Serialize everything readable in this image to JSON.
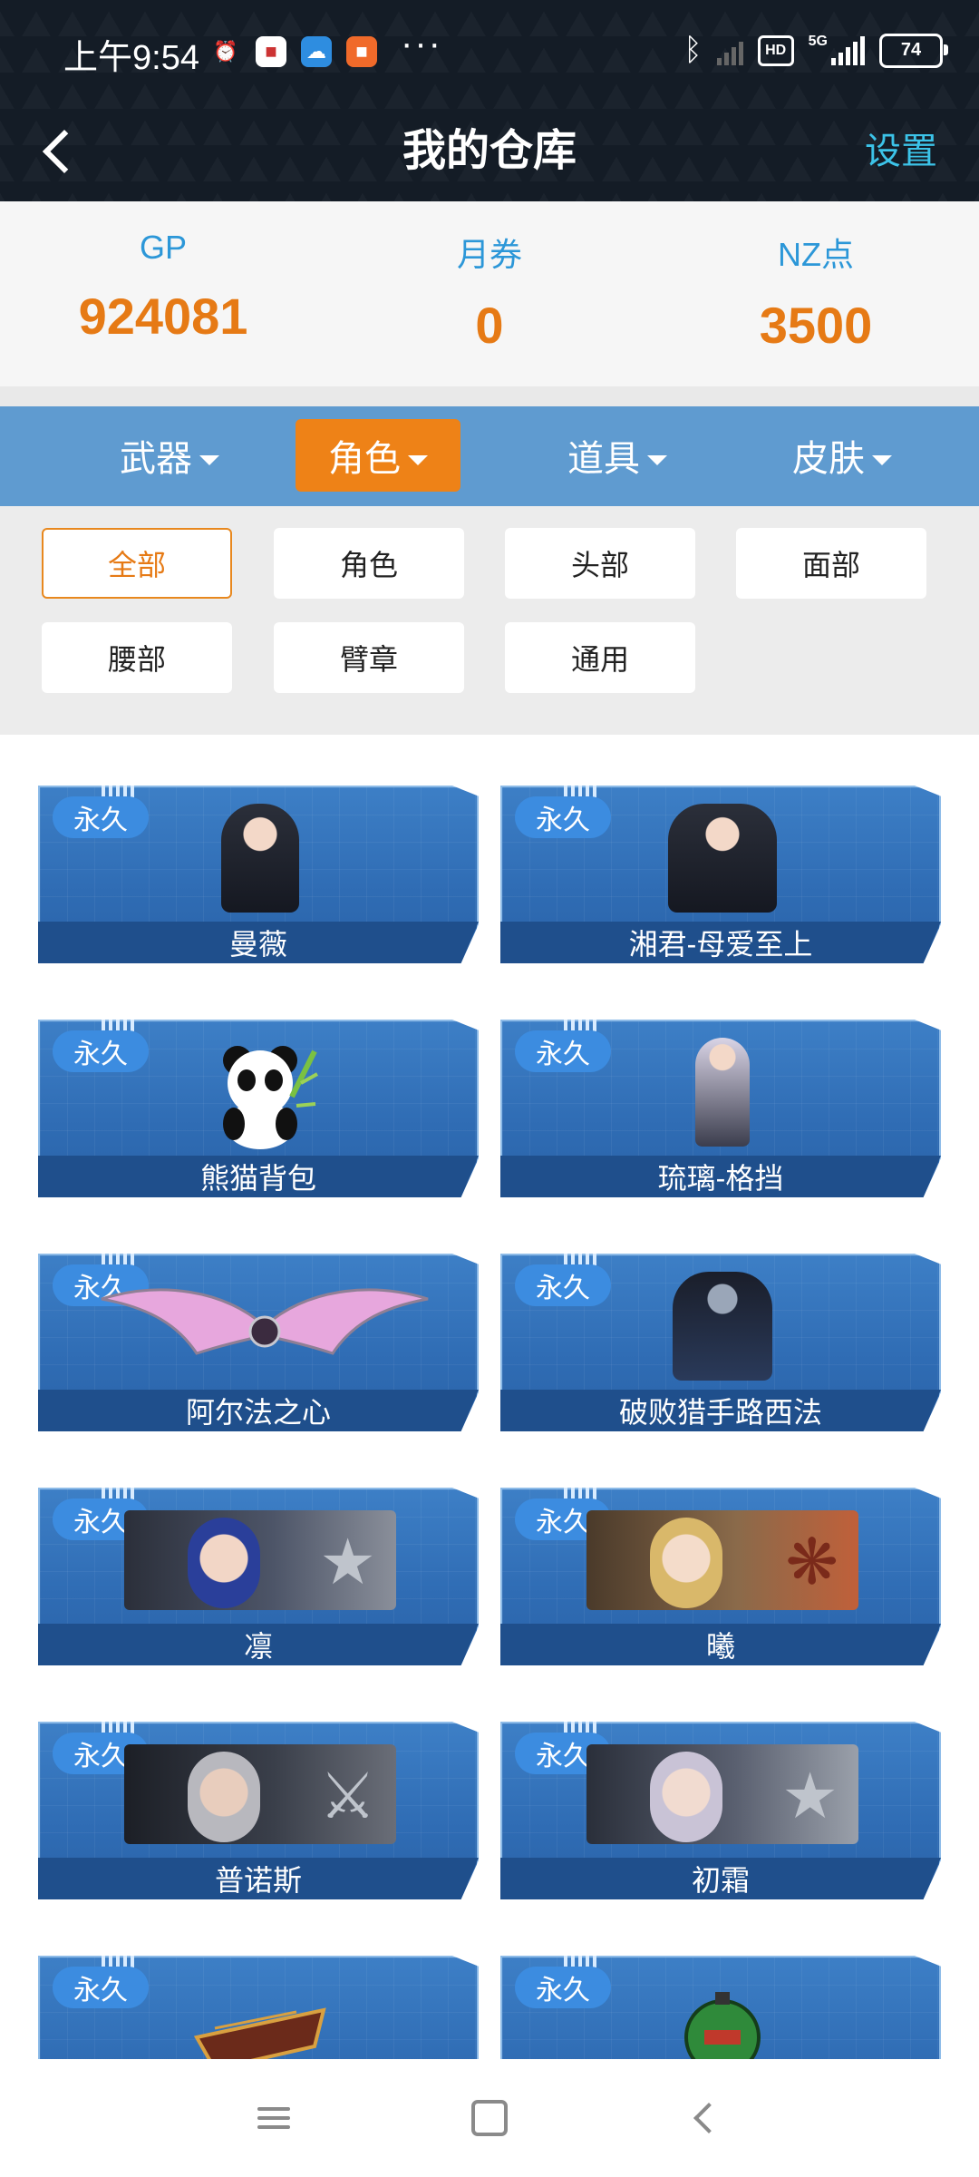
{
  "status_bar": {
    "time": "上午9:54",
    "more": "···",
    "hd": "HD",
    "network": "5G",
    "battery": "74"
  },
  "header": {
    "title": "我的仓库",
    "settings_label": "设置"
  },
  "currencies": [
    {
      "label": "GP",
      "value": "924081"
    },
    {
      "label": "月券",
      "value": "0"
    },
    {
      "label": "NZ点",
      "value": "3500"
    }
  ],
  "category_tabs": [
    {
      "label": "武器",
      "active": false
    },
    {
      "label": "角色",
      "active": true
    },
    {
      "label": "道具",
      "active": false
    },
    {
      "label": "皮肤",
      "active": false
    }
  ],
  "filters": [
    {
      "label": "全部",
      "active": true
    },
    {
      "label": "角色",
      "active": false
    },
    {
      "label": "头部",
      "active": false
    },
    {
      "label": "面部",
      "active": false
    },
    {
      "label": "腰部",
      "active": false
    },
    {
      "label": "臂章",
      "active": false
    },
    {
      "label": "通用",
      "active": false
    }
  ],
  "items": [
    {
      "badge": "永久",
      "name": "曼薇",
      "art": "character"
    },
    {
      "badge": "永久",
      "name": "湘君-母爱至上",
      "art": "character"
    },
    {
      "badge": "永久",
      "name": "熊猫背包",
      "art": "panda-backpack"
    },
    {
      "badge": "永久",
      "name": "琉璃-格挡",
      "art": "character"
    },
    {
      "badge": "永久",
      "name": "阿尔法之心",
      "art": "wings"
    },
    {
      "badge": "永久",
      "name": "破败猎手路西法",
      "art": "character"
    },
    {
      "badge": "永久",
      "name": "凛",
      "art": "banner"
    },
    {
      "badge": "永久",
      "name": "曦",
      "art": "banner"
    },
    {
      "badge": "永久",
      "name": "普诺斯",
      "art": "banner"
    },
    {
      "badge": "永久",
      "name": "初霜",
      "art": "banner"
    },
    {
      "badge": "永久",
      "name": "",
      "art": "boat"
    },
    {
      "badge": "永久",
      "name": "",
      "art": "grenade"
    }
  ],
  "colors": {
    "accent_orange": "#e67a15",
    "accent_blue": "#2c97d8",
    "tab_bar": "#5f9bd0",
    "card_blue": "#2f6cb4"
  }
}
